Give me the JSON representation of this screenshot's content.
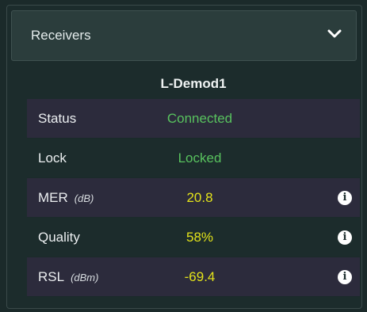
{
  "panel": {
    "header_title": "Receivers",
    "expand_icon": "chevron-down-icon"
  },
  "receiver": {
    "name": "L-Demod1",
    "rows": [
      {
        "label": "Status",
        "unit": "",
        "value": "Connected",
        "value_color": "#58c25e",
        "info": false
      },
      {
        "label": "Lock",
        "unit": "",
        "value": "Locked",
        "value_color": "#58c25e",
        "info": false
      },
      {
        "label": "MER",
        "unit": "(dB)",
        "value": "20.8",
        "value_color": "#e3e31a",
        "info": true
      },
      {
        "label": "Quality",
        "unit": "",
        "value": "58%",
        "value_color": "#e3e31a",
        "info": true
      },
      {
        "label": "RSL",
        "unit": "(dBm)",
        "value": "-69.4",
        "value_color": "#e3e31a",
        "info": true
      }
    ],
    "info_icon_glyph": "i"
  },
  "colors": {
    "background": "#1c2c2c",
    "shaded_row": "#2c2b3c",
    "good": "#58c25e",
    "warn": "#e3e31a"
  }
}
